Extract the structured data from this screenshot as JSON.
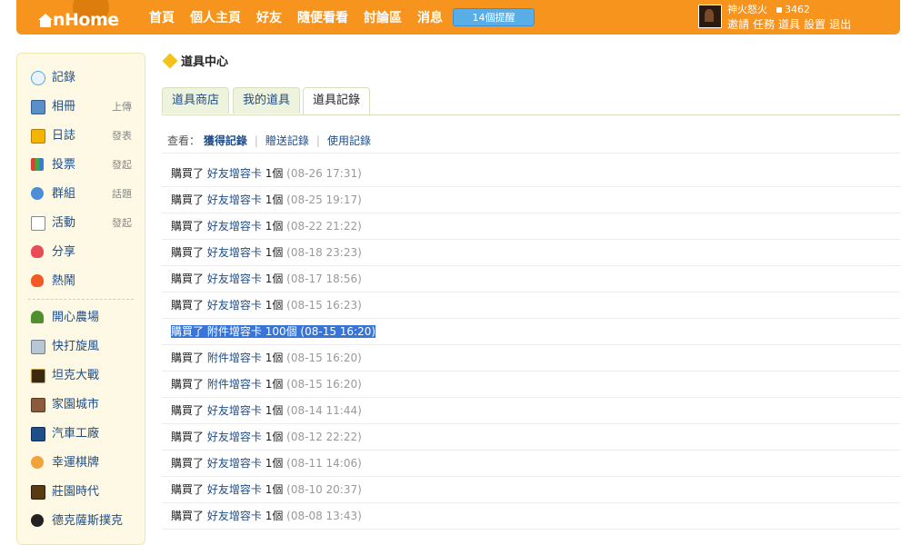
{
  "header": {
    "logo_text": "nHome",
    "nav": [
      "首頁",
      "個人主頁",
      "好友",
      "隨便看看",
      "討論區",
      "消息"
    ],
    "reminder": "14個提醒",
    "user": {
      "name": "神火怒火",
      "points": "3462",
      "links": [
        "邀請",
        "任務",
        "道具",
        "設置",
        "退出"
      ]
    },
    "accent": "#f7941d"
  },
  "sidebar": {
    "apps": [
      {
        "label": "記錄",
        "sub": "",
        "icon": "chat-bubble-icon"
      },
      {
        "label": "相冊",
        "sub": "上傳",
        "icon": "photo-album-icon"
      },
      {
        "label": "日誌",
        "sub": "發表",
        "icon": "diary-lock-icon"
      },
      {
        "label": "投票",
        "sub": "發起",
        "icon": "bar-chart-icon"
      },
      {
        "label": "群組",
        "sub": "話題",
        "icon": "group-icon"
      },
      {
        "label": "活動",
        "sub": "發起",
        "icon": "calendar-icon"
      },
      {
        "label": "分享",
        "sub": "",
        "icon": "heart-icon"
      },
      {
        "label": "熱鬧",
        "sub": "",
        "icon": "fire-icon"
      }
    ],
    "games": [
      {
        "label": "開心農場",
        "icon": "sprout-icon"
      },
      {
        "label": "快打旋風",
        "icon": "swords-icon"
      },
      {
        "label": "坦克大戰",
        "icon": "tank-icon"
      },
      {
        "label": "家園城市",
        "icon": "building-icon"
      },
      {
        "label": "汽車工廠",
        "icon": "car-factory-icon"
      },
      {
        "label": "幸運棋牌",
        "icon": "lucky-face-icon"
      },
      {
        "label": "莊園時代",
        "icon": "manor-icon"
      },
      {
        "label": "德克薩斯撲克",
        "icon": "poker-chip-icon"
      }
    ]
  },
  "main": {
    "title": "道具中心",
    "tabs": [
      "道具商店",
      "我的道具",
      "道具記錄"
    ],
    "active_tab": 2,
    "filter": {
      "label": "查看：",
      "options": [
        "獲得記錄",
        "贈送記錄",
        "使用記錄"
      ],
      "active": 0
    },
    "records": [
      {
        "action": "購買了",
        "item": "好友增容卡",
        "qty": "1個",
        "time": "(08-26 17:31)"
      },
      {
        "action": "購買了",
        "item": "好友增容卡",
        "qty": "1個",
        "time": "(08-25 19:17)"
      },
      {
        "action": "購買了",
        "item": "好友增容卡",
        "qty": "1個",
        "time": "(08-22 21:22)"
      },
      {
        "action": "購買了",
        "item": "好友增容卡",
        "qty": "1個",
        "time": "(08-18 23:23)"
      },
      {
        "action": "購買了",
        "item": "好友增容卡",
        "qty": "1個",
        "time": "(08-17 18:56)"
      },
      {
        "action": "購買了",
        "item": "好友增容卡",
        "qty": "1個",
        "time": "(08-15 16:23)"
      },
      {
        "action": "購買了",
        "item": "附件增容卡",
        "qty": "100個",
        "time": "(08-15 16:20)"
      },
      {
        "action": "購買了",
        "item": "附件增容卡",
        "qty": "1個",
        "time": "(08-15 16:20)"
      },
      {
        "action": "購買了",
        "item": "附件增容卡",
        "qty": "1個",
        "time": "(08-15 16:20)"
      },
      {
        "action": "購買了",
        "item": "好友增容卡",
        "qty": "1個",
        "time": "(08-14 11:44)"
      },
      {
        "action": "購買了",
        "item": "好友增容卡",
        "qty": "1個",
        "time": "(08-12 22:22)"
      },
      {
        "action": "購買了",
        "item": "好友增容卡",
        "qty": "1個",
        "time": "(08-11 14:06)"
      },
      {
        "action": "購買了",
        "item": "好友增容卡",
        "qty": "1個",
        "time": "(08-10 20:37)"
      },
      {
        "action": "購買了",
        "item": "好友增容卡",
        "qty": "1個",
        "time": "(08-08 13:43)"
      }
    ],
    "selected_record": 6
  }
}
